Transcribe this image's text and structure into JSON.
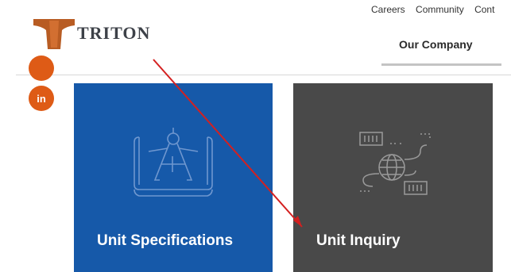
{
  "brand": {
    "name": "TRITON",
    "primary_color": "#1659a9",
    "secondary_color": "#494949",
    "accent_color": "#de5b16"
  },
  "utility_nav": {
    "items": [
      "Careers",
      "Community",
      "Cont"
    ]
  },
  "main_nav": {
    "active_item": "Our Company"
  },
  "social": {
    "linkedin_label": "in"
  },
  "tiles": [
    {
      "label": "Unit Specifications",
      "icon": "blueprint-compass-icon"
    },
    {
      "label": "Unit Inquiry",
      "icon": "globe-containers-icon"
    }
  ],
  "annotation": {
    "type": "red-arrow",
    "color": "#d42020"
  }
}
